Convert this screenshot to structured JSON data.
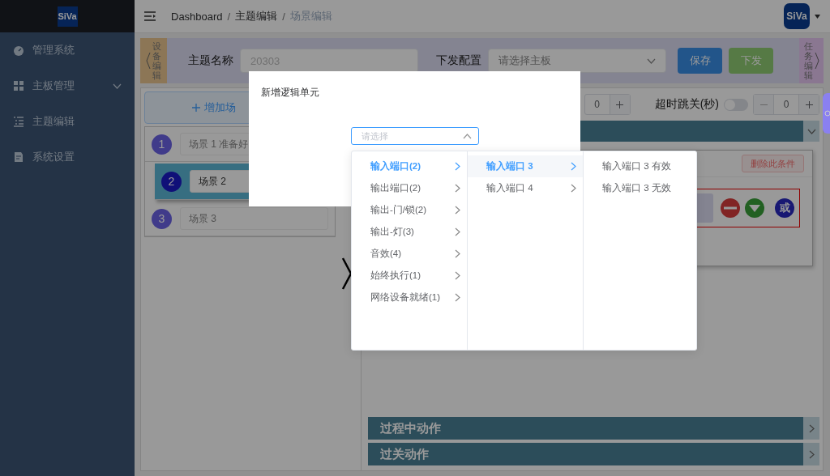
{
  "sidebar": {
    "logo_text": "SiVa",
    "items": [
      {
        "label": "管理系统",
        "kind": "link"
      },
      {
        "label": "主板管理",
        "kind": "group"
      },
      {
        "label": "主题编辑",
        "kind": "link"
      },
      {
        "label": "系统设置",
        "kind": "link"
      }
    ]
  },
  "header": {
    "breadcrumb": [
      "Dashboard",
      "主题编辑",
      "场景编辑"
    ],
    "separator": "/",
    "logo_text": "SiVa"
  },
  "toolbar": {
    "left_tab": "设备编辑",
    "name_label": "主题名称",
    "name_value": "20303",
    "config_label": "下发配置",
    "config_placeholder": "请选择主板",
    "buttons": [
      {
        "label": "保存",
        "kind": "primary"
      },
      {
        "label": "下发",
        "kind": "success"
      }
    ],
    "right_tab": "任务编辑"
  },
  "scenes": {
    "add_label": "增加场",
    "items": [
      {
        "number": "1",
        "name": "场景 1 准备好",
        "selected": false
      },
      {
        "number": "2",
        "name": "场景 2",
        "selected": true
      },
      {
        "number": "3",
        "name": "场景 3",
        "selected": false
      }
    ]
  },
  "timing": {
    "value_1": "0",
    "timeout_label": "超时跳关(秒)",
    "timeout_on": false,
    "value_2": "0"
  },
  "condition": {
    "delete_label": "删除此条件",
    "or_label": "或"
  },
  "sections": [
    "过程中动作",
    "过关动作"
  ],
  "dialog": {
    "title": "新增逻辑单元",
    "select_placeholder": "请选择",
    "columns": [
      {
        "items": [
          {
            "label": "输入端口(2)",
            "selected": true,
            "kind": "branch"
          },
          {
            "label": "输出端口(2)",
            "selected": false,
            "kind": "branch"
          },
          {
            "label": "输出-门/锁(2)",
            "selected": false,
            "kind": "branch"
          },
          {
            "label": "输出-灯(3)",
            "selected": false,
            "kind": "branch"
          },
          {
            "label": "音效(4)",
            "selected": false,
            "kind": "branch"
          },
          {
            "label": "始终执行(1)",
            "selected": false,
            "kind": "branch"
          },
          {
            "label": "网络设备就绪(1)",
            "selected": false,
            "kind": "branch"
          }
        ]
      },
      {
        "items": [
          {
            "label": "输入端口 3",
            "selected": true,
            "kind": "branch"
          },
          {
            "label": "输入端口 4",
            "selected": false,
            "kind": "branch"
          }
        ]
      },
      {
        "items": [
          {
            "label": "输入端口 3 有效",
            "selected": false,
            "kind": "leaf"
          },
          {
            "label": "输入端口 3 无效",
            "selected": false,
            "kind": "leaf"
          }
        ]
      }
    ]
  }
}
